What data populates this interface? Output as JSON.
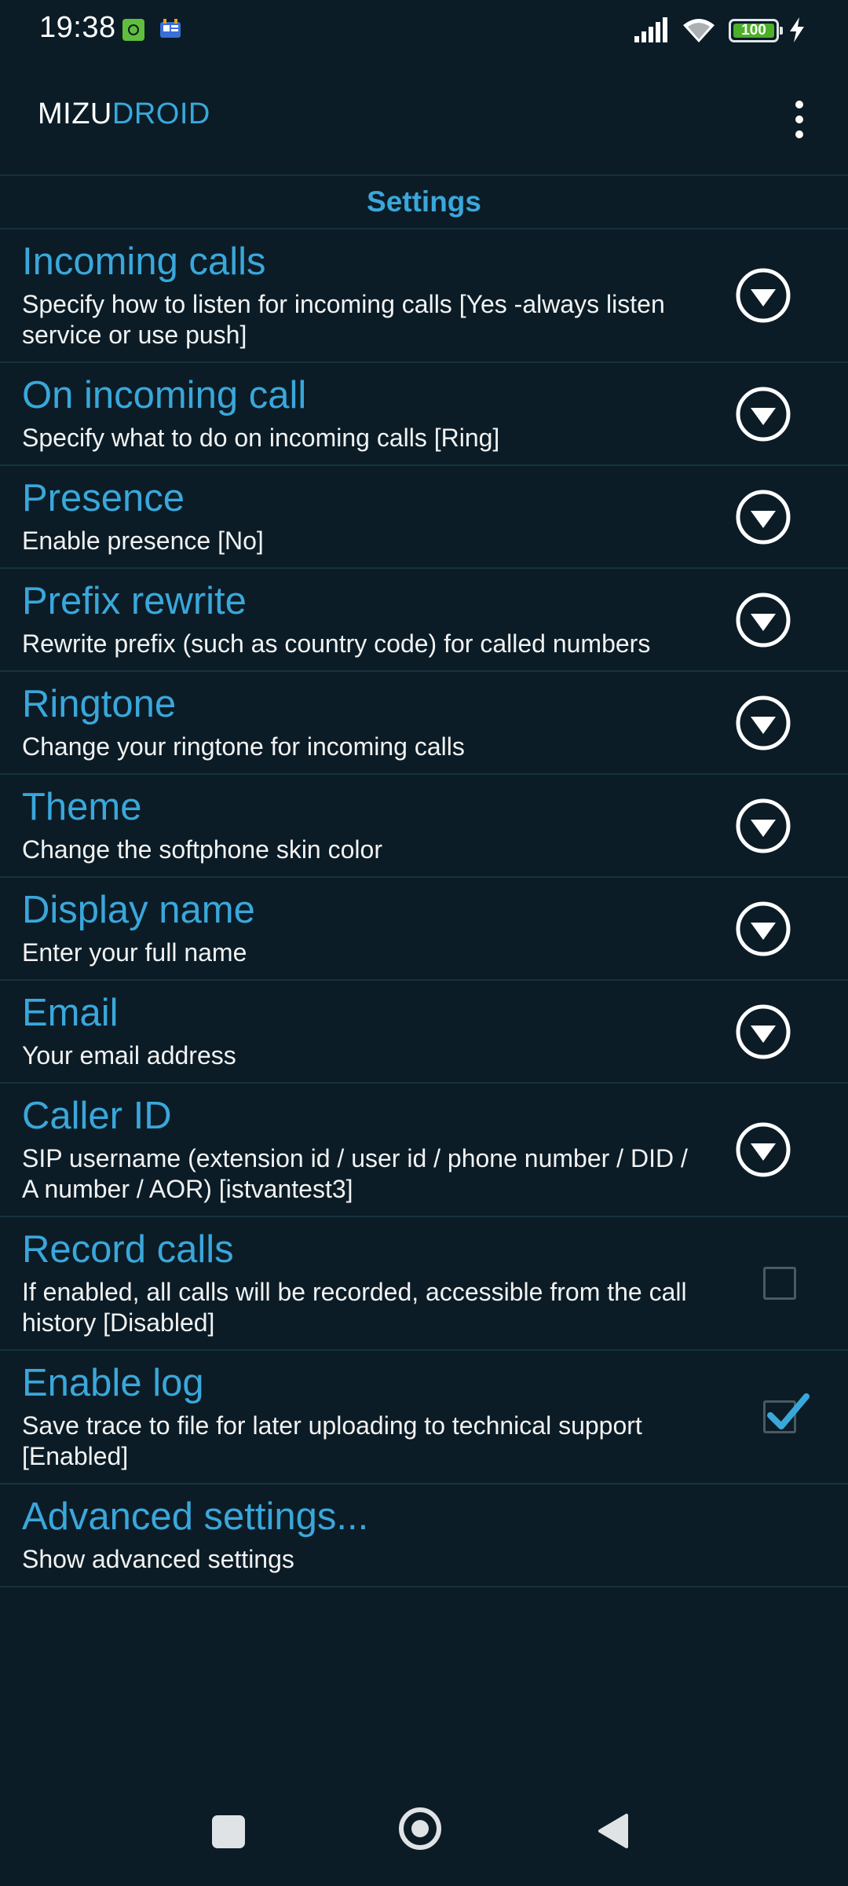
{
  "status_bar": {
    "time": "19:38",
    "battery_level": "100",
    "icons": [
      "notification-app-icon",
      "notification-card-icon",
      "signal-icon",
      "wifi-icon",
      "battery-icon",
      "charging-bolt-icon"
    ]
  },
  "app": {
    "title_part1": "MIZU",
    "title_part2": "DROID",
    "menu_icon": "overflow-menu-icon"
  },
  "section": {
    "title": "Settings"
  },
  "settings": [
    {
      "title": "Incoming calls",
      "description": "Specify how to listen for incoming calls [Yes -always listen service or use push]",
      "control": "dropdown"
    },
    {
      "title": "On incoming call",
      "description": "Specify what to do on incoming calls [Ring]",
      "control": "dropdown"
    },
    {
      "title": "Presence",
      "description": "Enable presence [No]",
      "control": "dropdown"
    },
    {
      "title": "Prefix rewrite",
      "description": "Rewrite prefix (such as country code) for called numbers",
      "control": "dropdown"
    },
    {
      "title": "Ringtone",
      "description": "Change your ringtone for incoming calls",
      "control": "dropdown"
    },
    {
      "title": "Theme",
      "description": "Change the softphone skin color",
      "control": "dropdown"
    },
    {
      "title": "Display name",
      "description": "Enter your full name",
      "control": "dropdown"
    },
    {
      "title": "Email",
      "description": "Your email address",
      "control": "dropdown"
    },
    {
      "title": "Caller ID",
      "description": "SIP username (extension id / user id / phone number / DID / A number / AOR) [istvantest3]",
      "control": "dropdown"
    },
    {
      "title": "Record calls",
      "description": "If enabled, all calls will be recorded, accessible from the call history [Disabled]",
      "control": "checkbox",
      "checked": false
    },
    {
      "title": "Enable log",
      "description": "Save trace to file for later uploading to technical support [Enabled]",
      "control": "checkbox",
      "checked": true
    },
    {
      "title": "Advanced settings...",
      "description": "Show advanced settings",
      "control": "none"
    }
  ],
  "colors": {
    "background": "#0b1c26",
    "accent": "#3aa7db",
    "divider": "#16323f",
    "text": "#f2f2f2"
  },
  "nav_bar": {
    "icons": [
      "recents-icon",
      "home-icon",
      "back-icon"
    ]
  }
}
